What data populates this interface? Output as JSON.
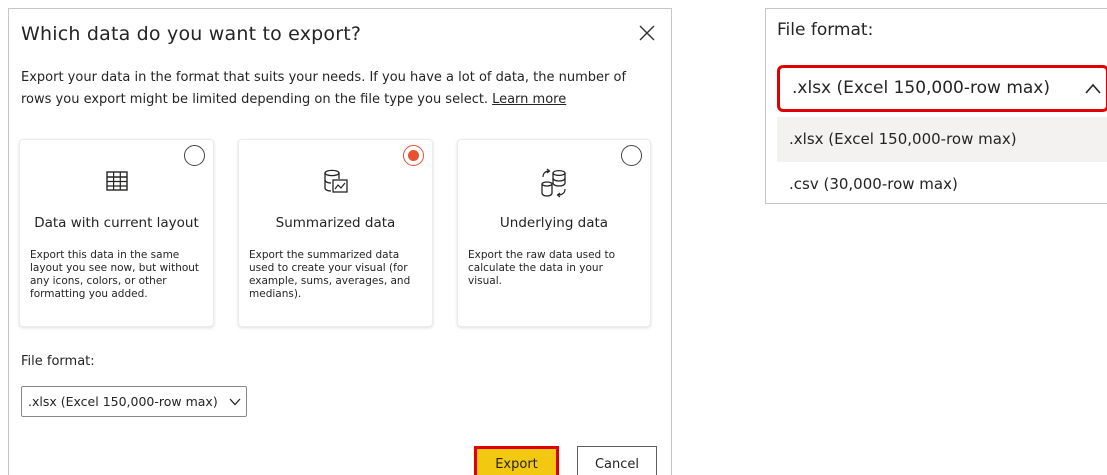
{
  "dialog": {
    "title": "Which data do you want to export?",
    "description": "Export your data in the format that suits your needs. If you have a lot of data, the number of rows you export might be limited depending on the file type you select.",
    "learn_more": "Learn more",
    "options": [
      {
        "title": "Data with current layout",
        "description": "Export this data in the same layout you see now, but without any icons, colors, or other formatting you added.",
        "icon": "table-icon",
        "selected": false
      },
      {
        "title": "Summarized data",
        "description": "Export the summarized data used to create your visual (for example, sums, averages, and medians).",
        "icon": "summarized-data-icon",
        "selected": true
      },
      {
        "title": "Underlying data",
        "description": "Export the raw data used to calculate the data in your visual.",
        "icon": "underlying-data-icon",
        "selected": false
      }
    ],
    "file_format_label": "File format:",
    "file_format_value": ".xlsx (Excel 150,000-row max)",
    "export_label": "Export",
    "cancel_label": "Cancel"
  },
  "zoom_panel": {
    "label": "File format:",
    "selected": ".xlsx (Excel 150,000-row max)",
    "options": [
      ".xlsx (Excel 150,000-row max)",
      ".csv (30,000-row max)"
    ]
  },
  "colors": {
    "accent_radio": "#e8502f",
    "export_button": "#f2c811",
    "highlight_border": "#e00000"
  }
}
